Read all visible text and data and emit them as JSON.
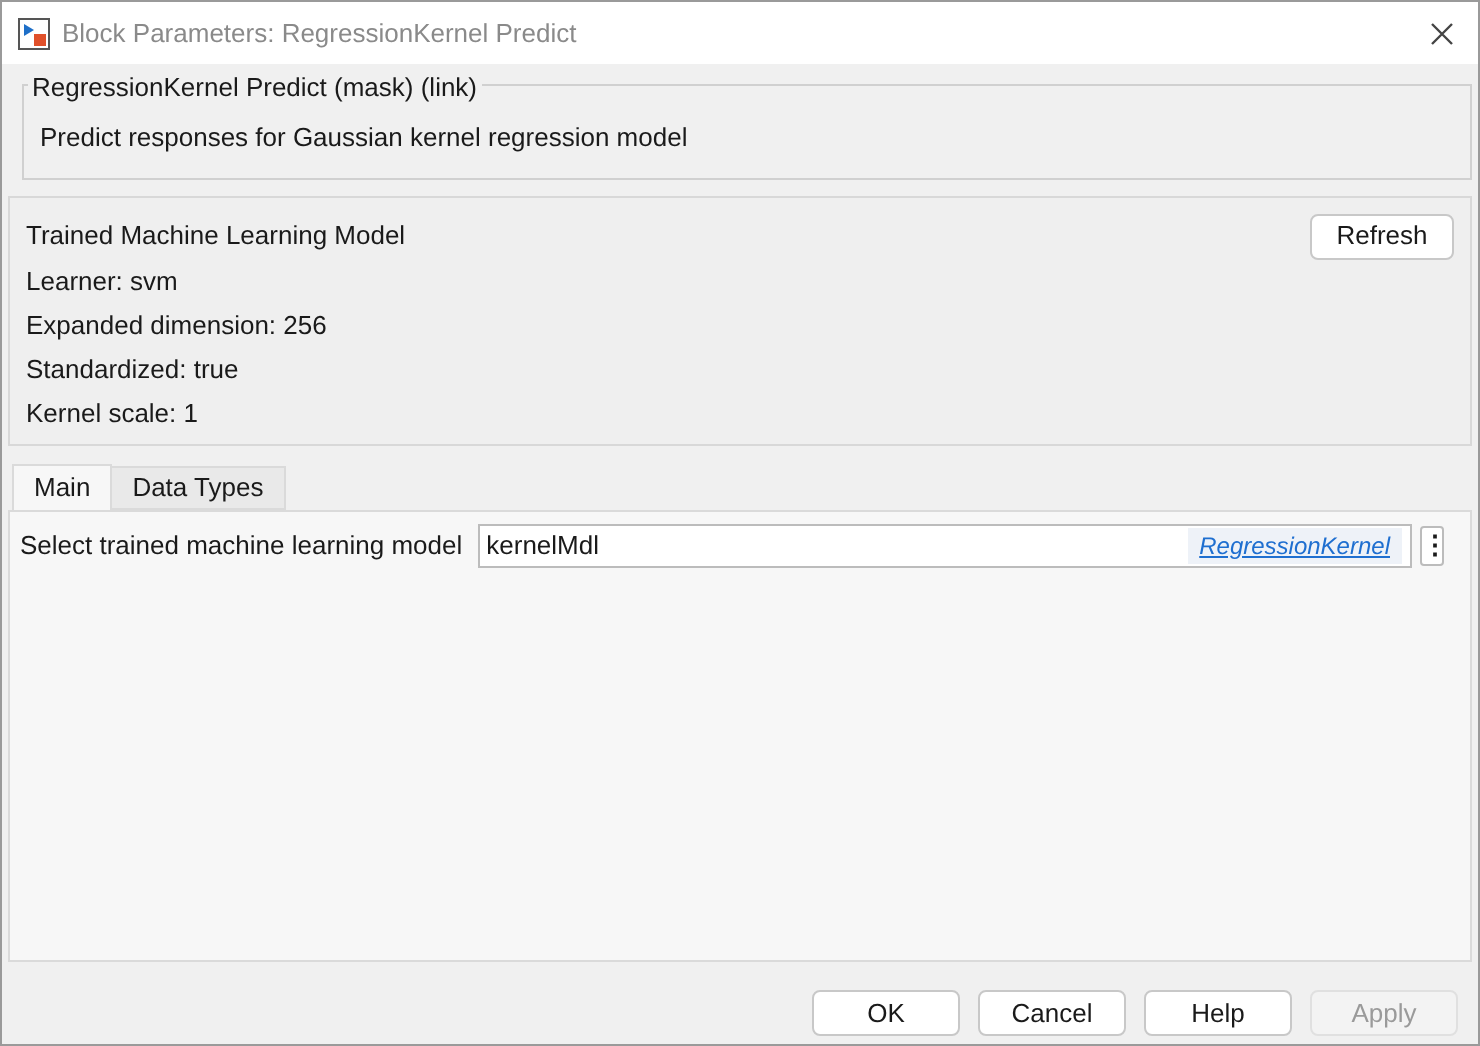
{
  "window": {
    "title": "Block Parameters: RegressionKernel Predict"
  },
  "mask": {
    "title": "RegressionKernel Predict (mask) (link)",
    "description": "Predict responses for Gaussian kernel regression model"
  },
  "model_panel": {
    "title": "Trained Machine Learning Model",
    "refresh_button": "Refresh",
    "details": [
      "Learner: svm",
      "Expanded dimension: 256",
      "Standardized: true",
      "Kernel scale: 1"
    ]
  },
  "tabs": [
    {
      "label": "Main",
      "selected": true
    },
    {
      "label": "Data Types",
      "selected": false
    }
  ],
  "parameter": {
    "label": "Select trained machine learning model",
    "value": "kernelMdl",
    "link": "RegressionKernel",
    "menu_button": "⋮"
  },
  "buttons": [
    {
      "label": "OK",
      "disabled": false
    },
    {
      "label": "Cancel",
      "disabled": false
    },
    {
      "label": "Help",
      "disabled": false
    },
    {
      "label": "Apply",
      "disabled": true
    }
  ]
}
